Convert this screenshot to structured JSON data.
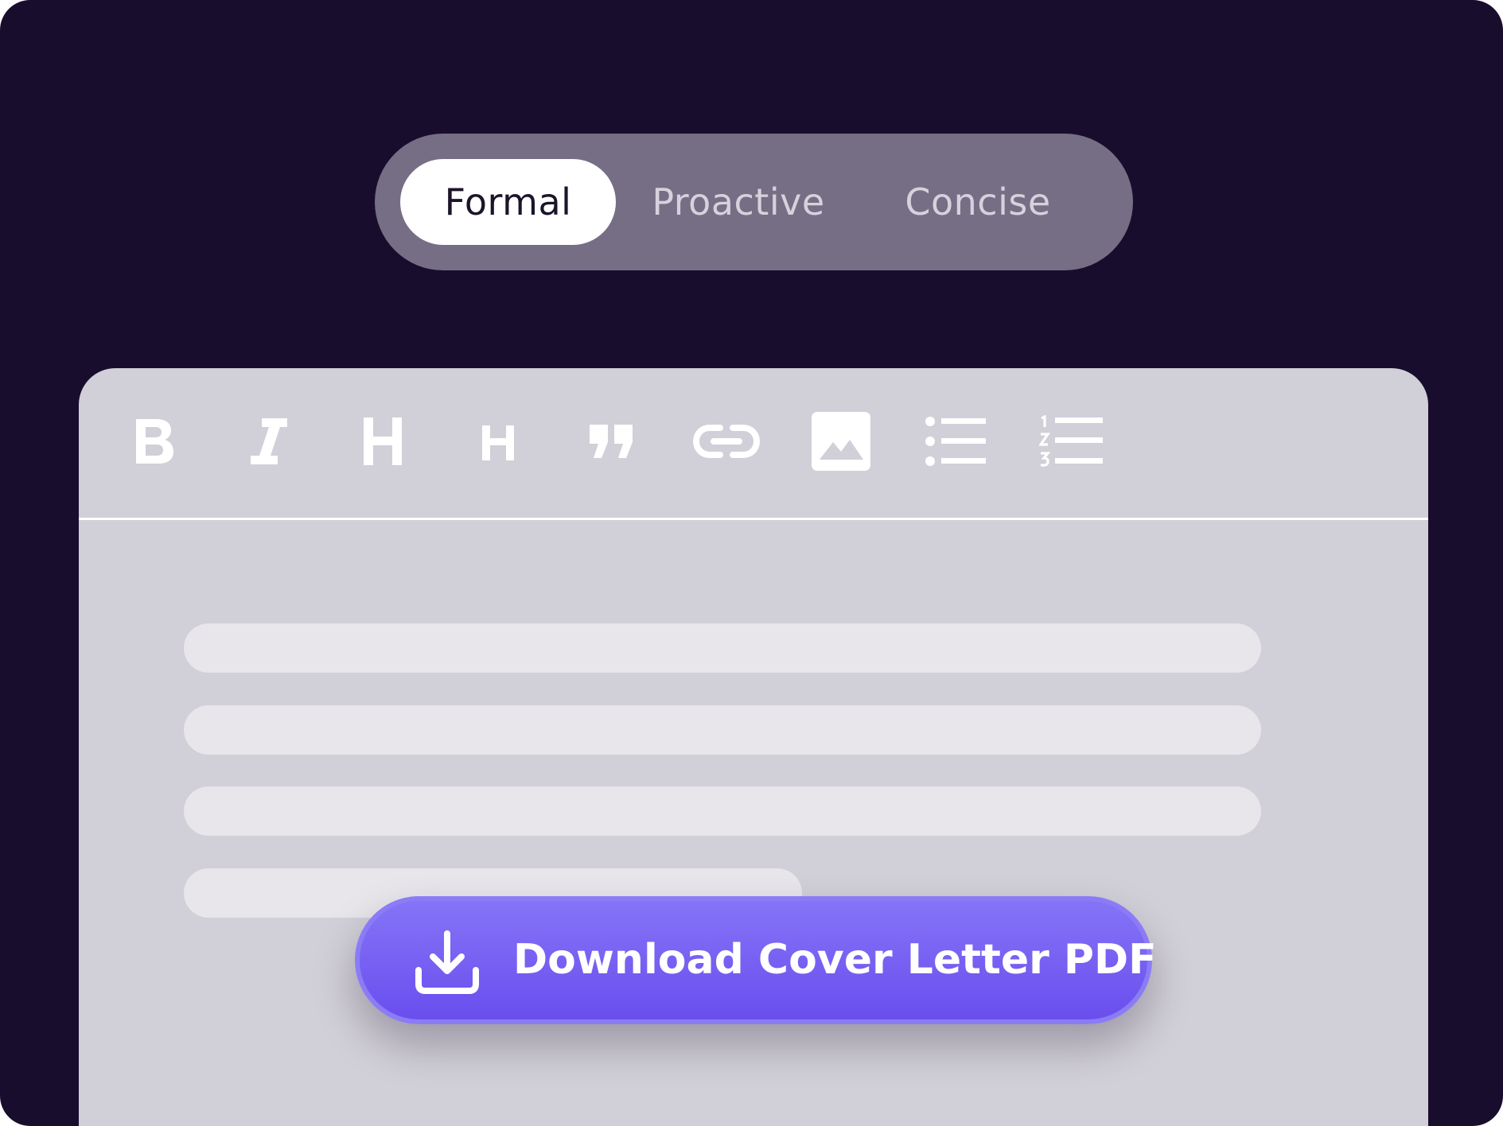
{
  "tone_selector": {
    "options": [
      {
        "label": "Formal",
        "selected": true
      },
      {
        "label": "Proactive",
        "selected": false
      },
      {
        "label": "Concise",
        "selected": false
      }
    ]
  },
  "toolbar": {
    "tools": [
      {
        "name": "bold",
        "icon": "bold-icon"
      },
      {
        "name": "italic",
        "icon": "italic-icon"
      },
      {
        "name": "heading-1",
        "icon": "heading-large-icon"
      },
      {
        "name": "heading-2",
        "icon": "heading-small-icon"
      },
      {
        "name": "blockquote",
        "icon": "quote-icon"
      },
      {
        "name": "link",
        "icon": "link-icon"
      },
      {
        "name": "image",
        "icon": "image-icon"
      },
      {
        "name": "bullet-list",
        "icon": "bullet-list-icon"
      },
      {
        "name": "numbered-list",
        "icon": "numbered-list-icon"
      }
    ]
  },
  "download_button": {
    "label": "Download Cover Letter PDF",
    "icon": "download-icon"
  },
  "colors": {
    "background": "#190d2e",
    "pill_track": "#766e84",
    "editor": "#d1cfd7",
    "placeholder_line": "#e8e6eb",
    "accent": "#6a4eee"
  }
}
